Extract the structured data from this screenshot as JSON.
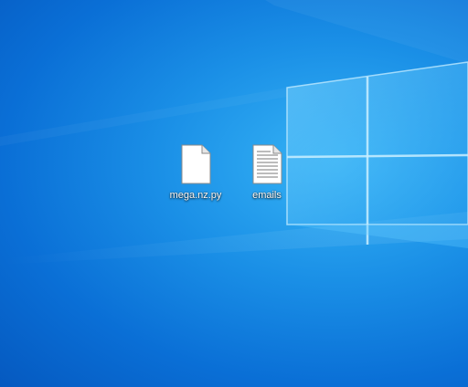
{
  "desktop": {
    "icons": [
      {
        "label": "mega.nz.py",
        "icon": "blank-file-icon"
      },
      {
        "label": "emails",
        "icon": "text-document-icon"
      }
    ]
  },
  "colors": {
    "wallpaper_deep": "#0559c0",
    "wallpaper_mid": "#1a8fe6",
    "wallpaper_light": "#36b4f6",
    "label_text": "#ffffff"
  }
}
